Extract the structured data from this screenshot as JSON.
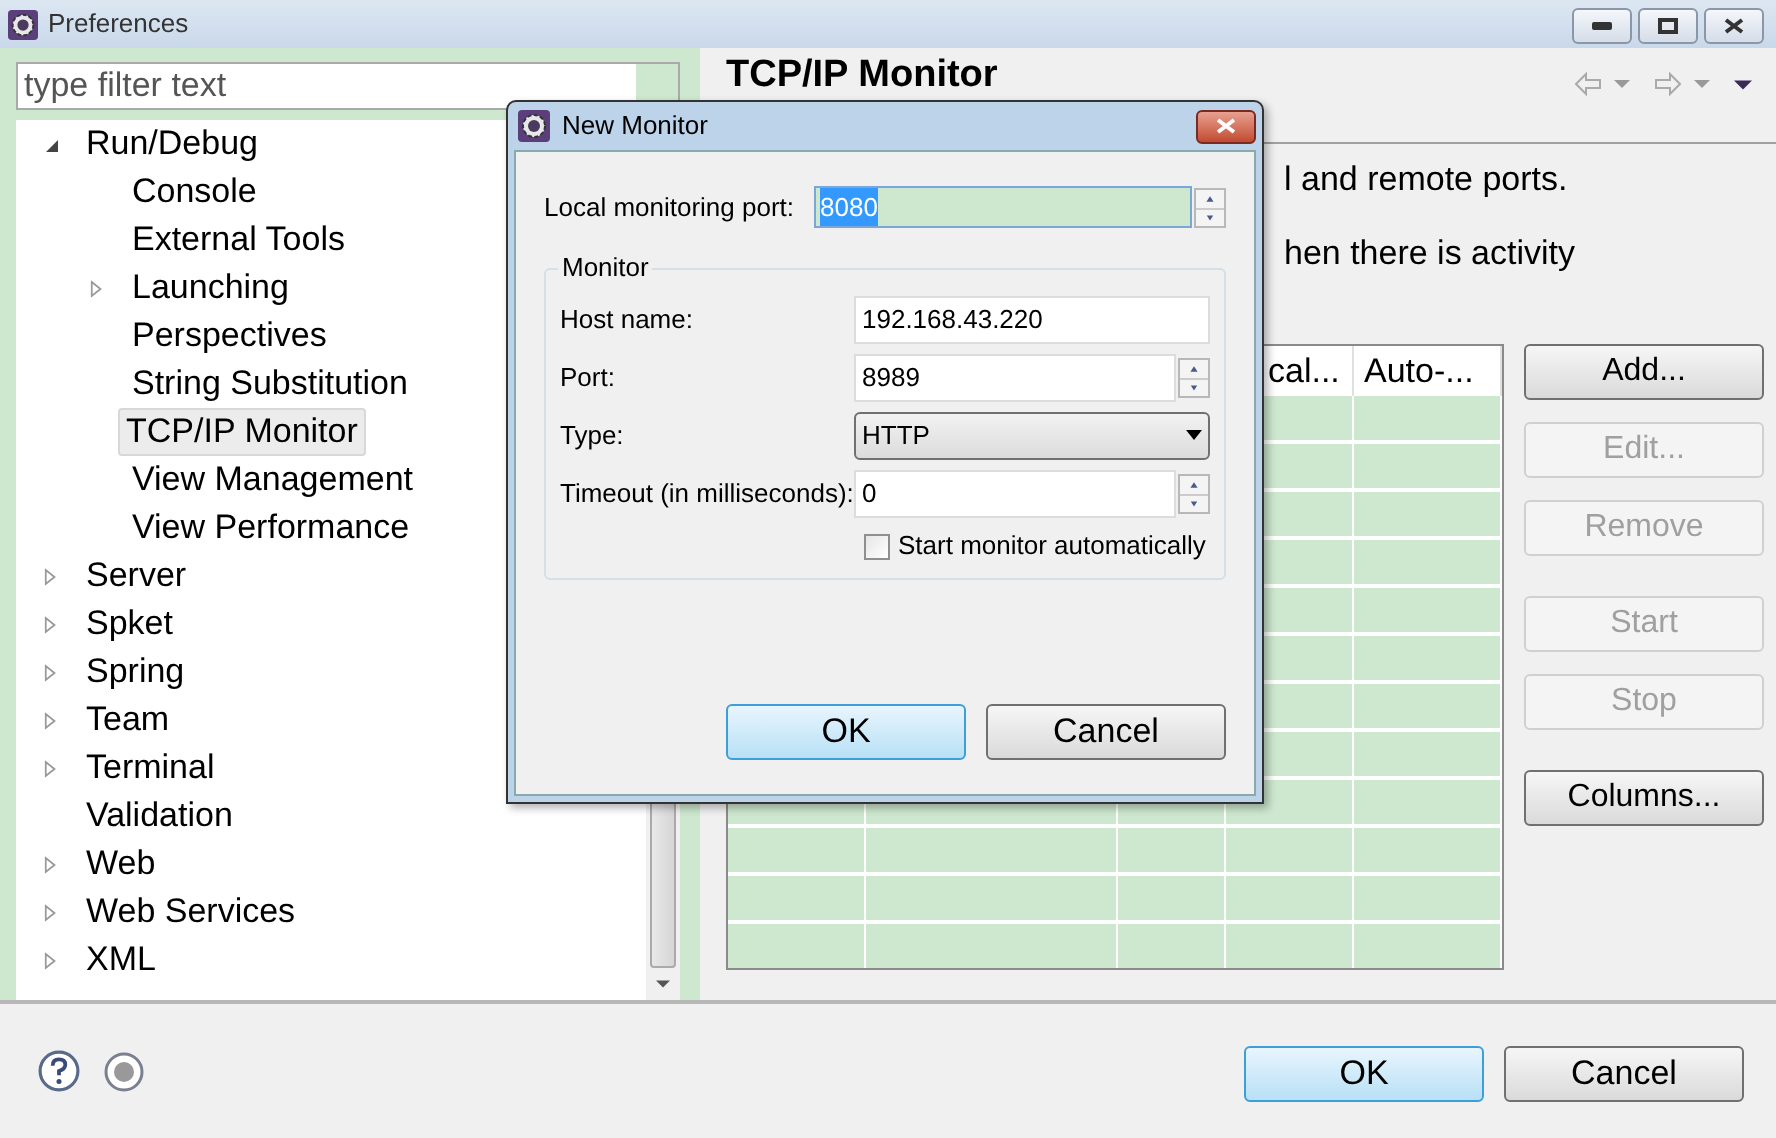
{
  "window": {
    "title": "Preferences"
  },
  "filter": {
    "placeholder": "type filter text"
  },
  "tree": [
    {
      "label": "Run/Debug",
      "has_children": true,
      "expanded": true,
      "selected": false,
      "children": [
        {
          "label": "Console",
          "has_children": false,
          "selected": false
        },
        {
          "label": "External Tools",
          "has_children": false,
          "selected": false
        },
        {
          "label": "Launching",
          "has_children": true,
          "expanded": false,
          "selected": false
        },
        {
          "label": "Perspectives",
          "has_children": false,
          "selected": false
        },
        {
          "label": "String Substitution",
          "has_children": false,
          "selected": false
        },
        {
          "label": "TCP/IP Monitor",
          "has_children": false,
          "selected": true
        },
        {
          "label": "View Management",
          "has_children": false,
          "selected": false
        },
        {
          "label": "View Performance",
          "has_children": false,
          "selected": false
        }
      ]
    },
    {
      "label": "Server",
      "has_children": true,
      "expanded": false,
      "selected": false
    },
    {
      "label": "Spket",
      "has_children": true,
      "expanded": false,
      "selected": false
    },
    {
      "label": "Spring",
      "has_children": true,
      "expanded": false,
      "selected": false
    },
    {
      "label": "Team",
      "has_children": true,
      "expanded": false,
      "selected": false
    },
    {
      "label": "Terminal",
      "has_children": true,
      "expanded": false,
      "selected": false
    },
    {
      "label": "Validation",
      "has_children": false,
      "selected": false
    },
    {
      "label": "Web",
      "has_children": true,
      "expanded": false,
      "selected": false
    },
    {
      "label": "Web Services",
      "has_children": true,
      "expanded": false,
      "selected": false
    },
    {
      "label": "XML",
      "has_children": true,
      "expanded": false,
      "selected": false
    }
  ],
  "page": {
    "title": "TCP/IP Monitor",
    "description": [
      "l and remote ports.",
      "hen there is activity"
    ],
    "table": {
      "columns": [
        "cal...",
        "Auto-..."
      ]
    },
    "buttons": [
      {
        "label": "Add...",
        "disabled": false
      },
      {
        "label": "Edit...",
        "disabled": true
      },
      {
        "label": "Remove",
        "disabled": true
      },
      {
        "label": "Start",
        "disabled": true
      },
      {
        "label": "Stop",
        "disabled": true
      },
      {
        "label": "Columns...",
        "disabled": false
      }
    ]
  },
  "dialog": {
    "title": "New Monitor",
    "local_port": {
      "label": "Local monitoring port:",
      "value": "8080",
      "text_selected": true
    },
    "group": "Monitor",
    "fields": [
      {
        "kind": "text",
        "label": "Host name:",
        "value": "192.168.43.220"
      },
      {
        "kind": "spinner",
        "label": "Port:",
        "value": "8989"
      },
      {
        "kind": "combo",
        "label": "Type:",
        "value": "HTTP"
      },
      {
        "kind": "spinner",
        "label": "Timeout (in milliseconds):",
        "value": "0"
      }
    ],
    "checkbox": {
      "label": "Start monitor automatically",
      "checked": false
    },
    "buttons": [
      {
        "label": "OK",
        "default": true
      },
      {
        "label": "Cancel",
        "default": false
      }
    ]
  },
  "footer": {
    "buttons": [
      {
        "label": "OK",
        "default": true
      },
      {
        "label": "Cancel",
        "default": false
      }
    ]
  }
}
